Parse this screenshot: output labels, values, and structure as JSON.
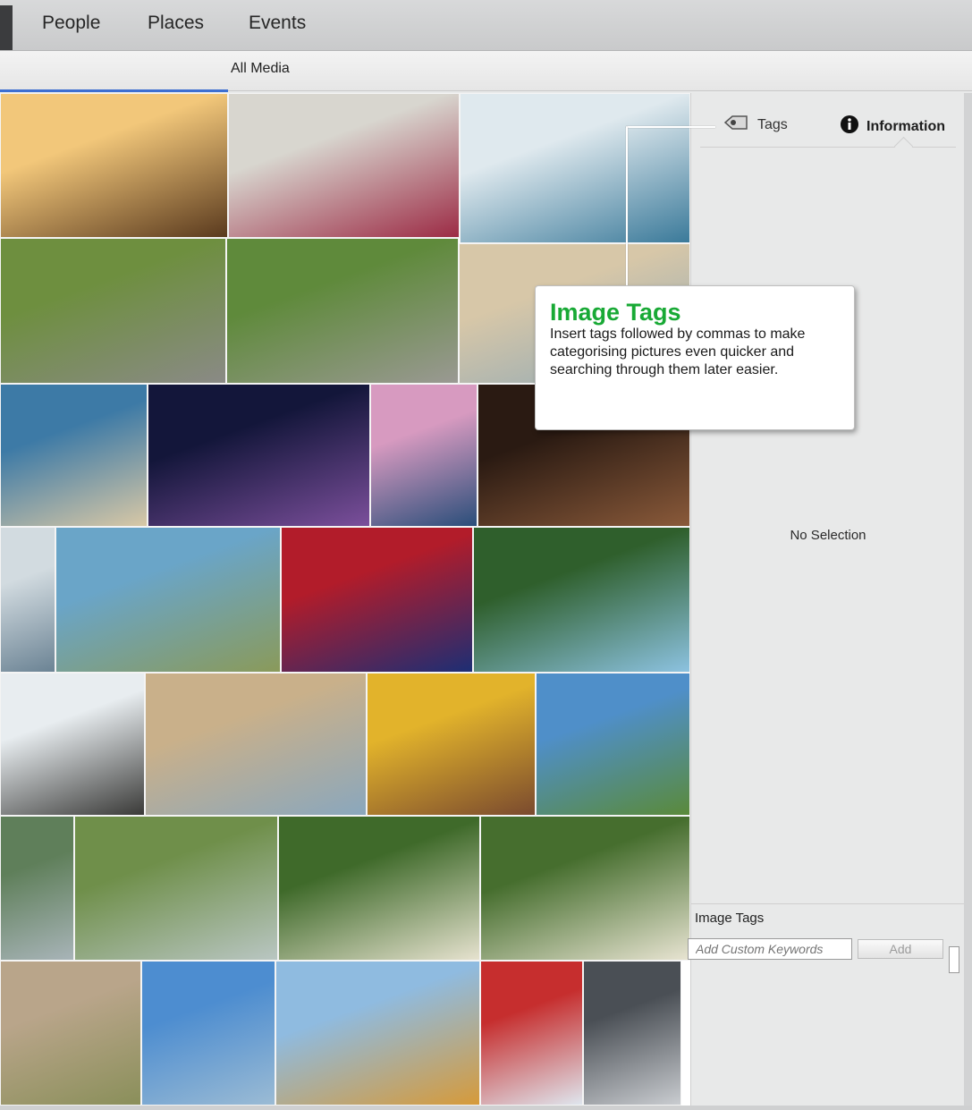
{
  "nav": {
    "items": [
      {
        "label": "People"
      },
      {
        "label": "Places"
      },
      {
        "label": "Events"
      }
    ]
  },
  "subnav": {
    "label": "All Media"
  },
  "panel": {
    "tabs": [
      {
        "label": "Tags",
        "icon": "tag-icon"
      },
      {
        "label": "Information",
        "icon": "info-icon"
      }
    ],
    "empty_state": "No Selection",
    "image_tags": {
      "title": "Image Tags",
      "placeholder": "Add Custom Keywords",
      "add_label": "Add"
    }
  },
  "callout": {
    "title": "Image Tags",
    "body": "Insert tags followed by commas to make categorising pictures even quicker and searching through them later easier."
  },
  "photos": [
    {
      "subject": "couple at sunset lake",
      "colors": [
        "#f2c77a",
        "#5a3a1e"
      ]
    },
    {
      "subject": "red ribbon on branch",
      "colors": [
        "#d8d6cf",
        "#9c2b45"
      ]
    },
    {
      "subject": "jet ski",
      "colors": [
        "#dfe9ee",
        "#3b7a9a"
      ]
    },
    {
      "subject": "runners on park path",
      "colors": [
        "#6e8f3f",
        "#8a8a86"
      ]
    },
    {
      "subject": "runners on park path",
      "colors": [
        "#5f8a3b",
        "#9a9993"
      ]
    },
    {
      "subject": "beach person",
      "colors": [
        "#d7c7a8",
        "#8fa8b5"
      ]
    },
    {
      "subject": "mother and daughter on beach",
      "colors": [
        "#3d7aa6",
        "#d8c8a6"
      ]
    },
    {
      "subject": "fireworks over pier",
      "colors": [
        "#13163a",
        "#7b4f9b"
      ]
    },
    {
      "subject": "coastal rock arch",
      "colors": [
        "#d79ac0",
        "#2a4e7a"
      ]
    },
    {
      "subject": "portrait man night",
      "colors": [
        "#2a1a12",
        "#8a5a3a"
      ]
    },
    {
      "subject": "sea with buoy",
      "colors": [
        "#d2dbe0",
        "#6b8394"
      ]
    },
    {
      "subject": "bay with airplane",
      "colors": [
        "#6aa5c8",
        "#8a9a5a"
      ]
    },
    {
      "subject": "union jack flowers",
      "colors": [
        "#b21c2a",
        "#1d2e74"
      ]
    },
    {
      "subject": "park trees",
      "colors": [
        "#2f5f2c",
        "#8cc2e0"
      ]
    },
    {
      "subject": "rocky shore",
      "colors": [
        "#e8edf0",
        "#3a3a38"
      ]
    },
    {
      "subject": "sandy beach",
      "colors": [
        "#c9b08a",
        "#8aa7bd"
      ]
    },
    {
      "subject": "woman portrait sunflowers",
      "colors": [
        "#e2b32b",
        "#7a4a2e"
      ]
    },
    {
      "subject": "friends on promenade",
      "colors": [
        "#4f8fc9",
        "#5a8a3a"
      ]
    },
    {
      "subject": "canal walkway",
      "colors": [
        "#5f7f5a",
        "#a8b4b8"
      ]
    },
    {
      "subject": "garden building",
      "colors": [
        "#6f8f4a",
        "#b9c6c2"
      ]
    },
    {
      "subject": "smiling man in garden",
      "colors": [
        "#3f6a2a",
        "#e6e2cf"
      ]
    },
    {
      "subject": "smiling man in garden",
      "colors": [
        "#466e2e",
        "#e8e4d2"
      ]
    },
    {
      "subject": "beach huts",
      "colors": [
        "#b9a58a",
        "#8a8f5a"
      ]
    },
    {
      "subject": "ocean sky",
      "colors": [
        "#4d8dd0",
        "#9bbbd4"
      ]
    },
    {
      "subject": "man with surfboard",
      "colors": [
        "#8fbbe0",
        "#d69a3a"
      ]
    },
    {
      "subject": "child in snow",
      "colors": [
        "#c62e2e",
        "#dfe6ee"
      ]
    },
    {
      "subject": "beanie portrait",
      "colors": [
        "#4a4f55",
        "#c9ccd0"
      ]
    }
  ]
}
